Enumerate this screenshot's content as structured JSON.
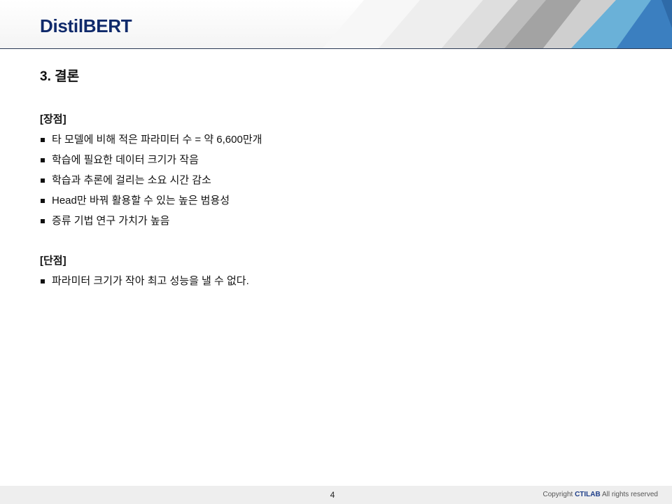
{
  "slide": {
    "title": "DistilBERT",
    "section_heading": "3. 결론"
  },
  "pros": {
    "label": "[장점]",
    "items": [
      "타 모델에 비해 적은 파라미터 수 = 약 6,600만개",
      "학습에 필요한 데이터 크기가 작음",
      "학습과 추론에 걸리는 소요 시간 감소",
      "Head만 바꿔 활용할 수 있는 높은 범용성",
      "증류 기법 연구 가치가 높음"
    ]
  },
  "cons": {
    "label": "[단점]",
    "items": [
      "파라미터 크기가 작아 최고 성능을 낼 수 없다."
    ]
  },
  "footer": {
    "page_number": "4",
    "copyright_prefix": "Copyright ",
    "copyright_brand": "CTILAB",
    "copyright_suffix": " All rights reserved"
  },
  "colors": {
    "title": "#102a6b",
    "header_rule": "#2b3a55",
    "accent_light_blue": "#6ab1d8",
    "accent_blue": "#3b7fc0"
  }
}
